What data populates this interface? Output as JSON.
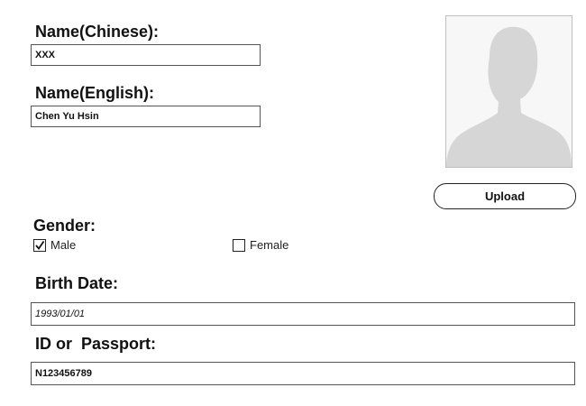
{
  "form": {
    "name_chinese": {
      "label": "Name(Chinese):",
      "value": "XXX"
    },
    "name_english": {
      "label": "Name(English):",
      "value": "Chen Yu Hsin"
    },
    "photo": {
      "icon": "person-silhouette-icon",
      "upload_label": "Upload"
    },
    "gender": {
      "label": "Gender:",
      "options": [
        {
          "label": "Male",
          "checked": true
        },
        {
          "label": "Female",
          "checked": false
        }
      ]
    },
    "birth_date": {
      "label": "Birth Date:",
      "value": "1993/01/01"
    },
    "id_passport": {
      "label": "ID or  Passport:",
      "value": "N123456789"
    }
  },
  "colors": {
    "border": "#555555",
    "silhouette": "#d6d6d6",
    "photo_bg": "#f7f7f7"
  }
}
